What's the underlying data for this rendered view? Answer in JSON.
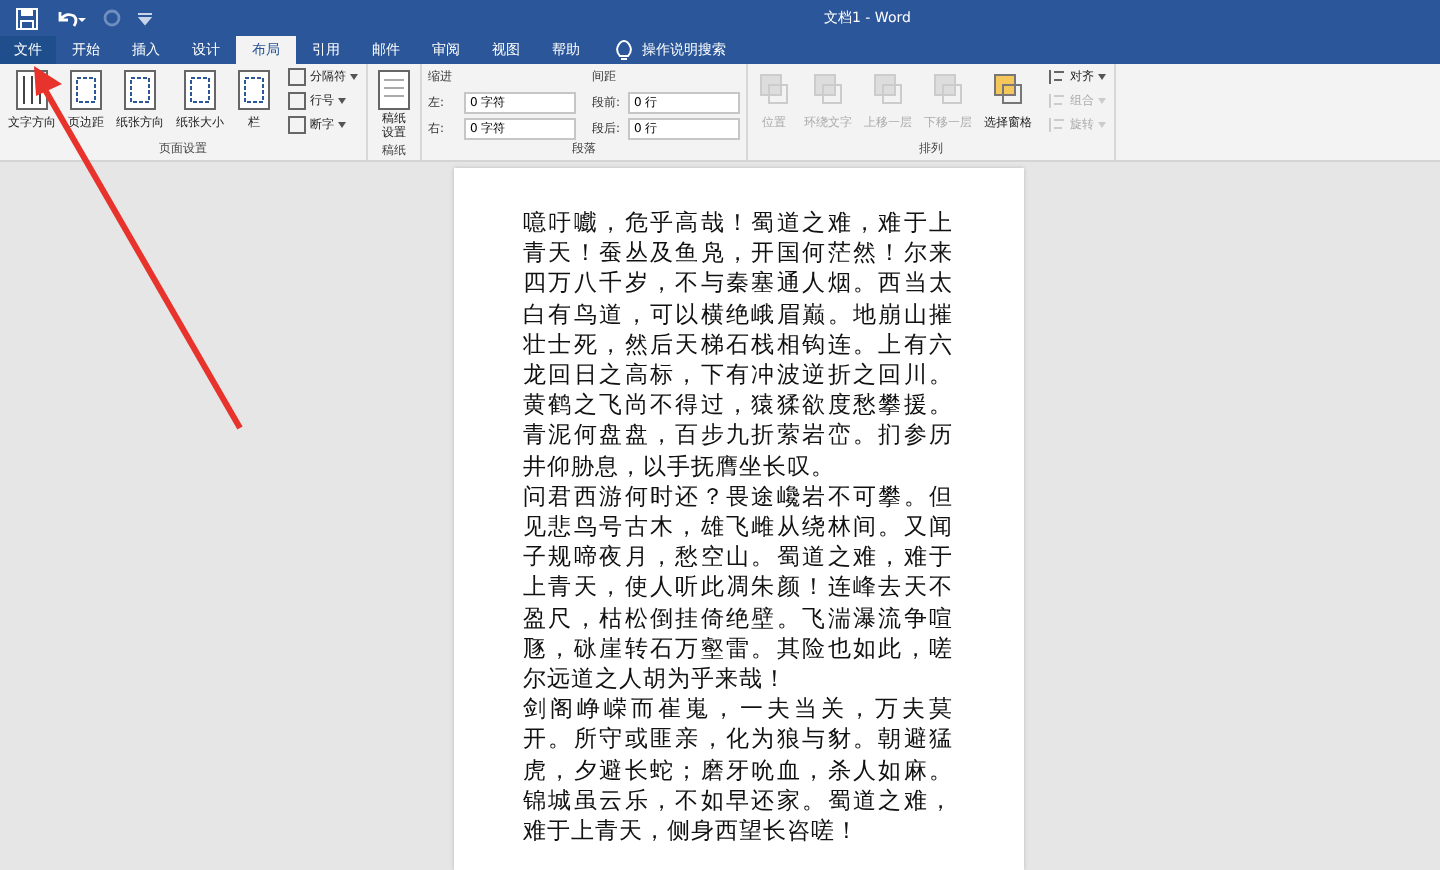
{
  "window": {
    "title": "文档1 - Word"
  },
  "tabs": [
    {
      "label": "文件",
      "selected": false,
      "kind": "file"
    },
    {
      "label": "开始",
      "selected": false,
      "kind": "tab"
    },
    {
      "label": "插入",
      "selected": false,
      "kind": "tab"
    },
    {
      "label": "设计",
      "selected": false,
      "kind": "tab"
    },
    {
      "label": "布局",
      "selected": true,
      "kind": "tab"
    },
    {
      "label": "引用",
      "selected": false,
      "kind": "tab"
    },
    {
      "label": "邮件",
      "selected": false,
      "kind": "tab"
    },
    {
      "label": "审阅",
      "selected": false,
      "kind": "tab"
    },
    {
      "label": "视图",
      "selected": false,
      "kind": "tab"
    },
    {
      "label": "帮助",
      "selected": false,
      "kind": "tab"
    }
  ],
  "tell_me": {
    "placeholder": "操作说明搜索"
  },
  "ribbon": {
    "page_setup": {
      "big_buttons": [
        "文字方向",
        "页边距",
        "纸张方向",
        "纸张大小",
        "栏"
      ],
      "small_buttons": [
        "分隔符",
        "行号",
        "断字"
      ],
      "label": "页面设置"
    },
    "draft": {
      "button": "稿纸设置",
      "label": "稿纸"
    },
    "paragraph": {
      "indent_label": "缩进",
      "spacing_label": "间距",
      "fields": [
        {
          "label": "左:",
          "value": "0 字符"
        },
        {
          "label": "右:",
          "value": "0 字符"
        },
        {
          "label": "段前:",
          "value": "0 行"
        },
        {
          "label": "段后:",
          "value": "0 行"
        }
      ],
      "label": "段落"
    },
    "arrange": {
      "big_buttons": [
        {
          "label": "位置",
          "disabled": true
        },
        {
          "label": "环绕文字",
          "disabled": true
        },
        {
          "label": "上移一层",
          "disabled": true
        },
        {
          "label": "下移一层",
          "disabled": true
        },
        {
          "label": "选择窗格",
          "disabled": false
        }
      ],
      "small_buttons": [
        {
          "label": "对齐",
          "disabled": false
        },
        {
          "label": "组合",
          "disabled": true
        },
        {
          "label": "旋转",
          "disabled": true
        }
      ],
      "label": "排列"
    }
  },
  "document": {
    "paragraphs": [
      "噫吁嚱，危乎高哉！蜀道之难，难于上青天！蚕丛及鱼凫，开国何茫然！尔来四万八千岁，不与秦塞通人烟。西当太白有鸟道，可以横绝峨眉巅。地崩山摧壮士死，然后天梯石栈相钩连。上有六龙回日之高标，下有冲波逆折之回川。黄鹤之飞尚不得过，猿猱欲度愁攀援。青泥何盘盘，百步九折萦岩峦。扪参历井仰胁息，以手抚膺坐长叹。",
      "问君西游何时还？畏途巉岩不可攀。但见悲鸟号古木，雄飞雌从绕林间。又闻子规啼夜月，愁空山。蜀道之难，难于上青天，使人听此凋朱颜！连峰去天不盈尺，枯松倒挂倚绝壁。飞湍瀑流争喧豗，砯崖转石万壑雷。其险也如此，嗟尔远道之人胡为乎来哉！",
      "剑阁峥嵘而崔嵬，一夫当关，万夫莫开。所守或匪亲，化为狼与豺。朝避猛虎，夕避长蛇；磨牙吮血，杀人如麻。锦城虽云乐，不如早还家。蜀道之难，难于上青天，侧身西望长咨嗟！"
    ]
  }
}
